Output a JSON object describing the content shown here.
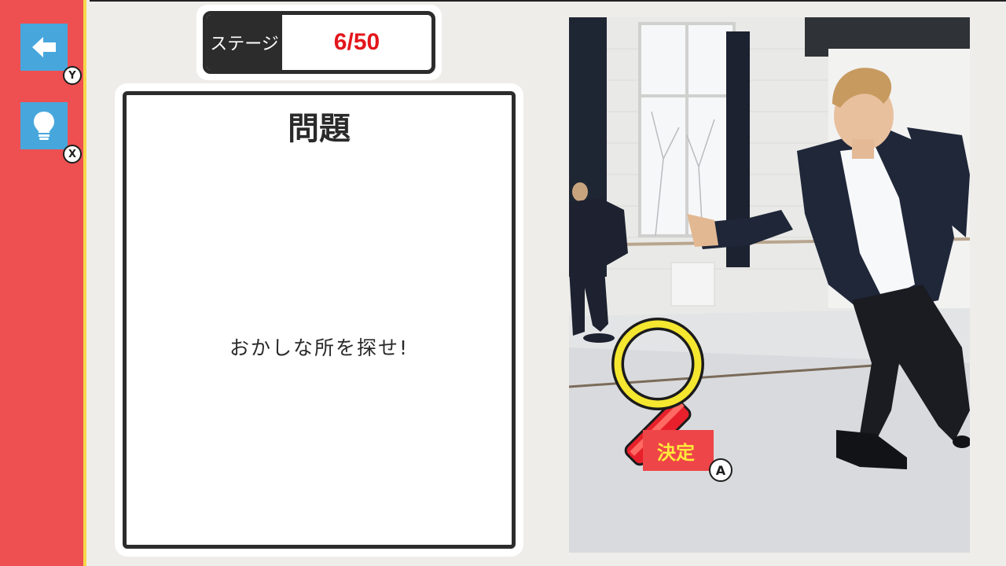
{
  "sidebar": {
    "back": {
      "key": "Y",
      "icon": "arrow-left-icon"
    },
    "hint": {
      "key": "X",
      "icon": "lightbulb-icon"
    }
  },
  "stage": {
    "label": "ステージ",
    "value": "6/50"
  },
  "question": {
    "title": "問題",
    "prompt": "おかしな所を探せ!"
  },
  "cursor": {
    "confirm_label": "決定",
    "key": "A",
    "icon": "magnifier-icon"
  },
  "colors": {
    "sidebar": "#ee4f50",
    "button": "#47a7dd",
    "stage_value": "#e3161c",
    "confirm_bg": "#ee4548",
    "confirm_text": "#ffe93a",
    "magnifier_ring": "#f5e630"
  }
}
